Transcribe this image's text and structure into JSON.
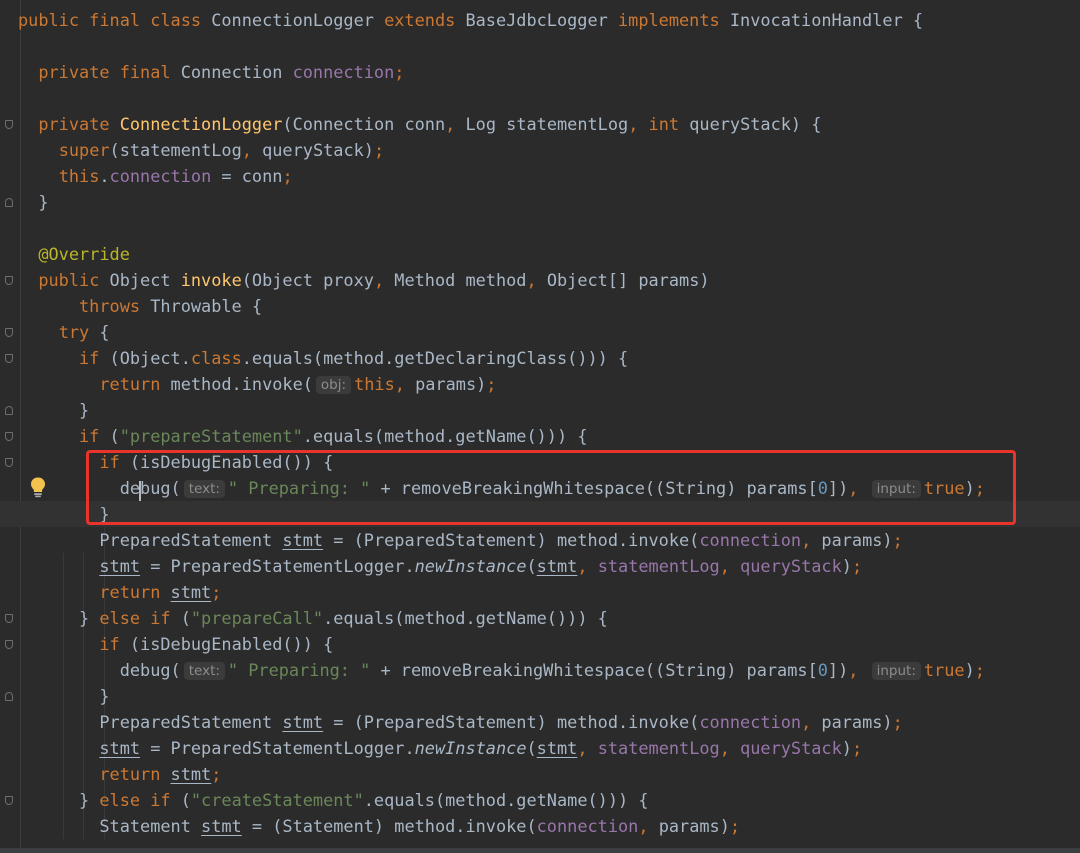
{
  "editor": {
    "language": "java",
    "colors": {
      "background": "#2b2b2b",
      "current_line": "#323232",
      "text": "#a9b7c6",
      "keyword": "#cc7832",
      "field": "#9876aa",
      "method_decl": "#ffc66d",
      "string": "#6a8759",
      "number": "#6897bb",
      "annotation": "#bbb529",
      "highlight_box": "#e8342b"
    },
    "highlighted_lines": [
      18,
      19,
      20
    ],
    "current_line": 19,
    "gutter_icons": [
      "fold-marker-icon",
      "lightbulb-icon"
    ],
    "lines": [
      [
        {
          "t": "public final class ",
          "c": "kw"
        },
        {
          "t": "ConnectionLogger "
        },
        {
          "t": "extends ",
          "c": "kw"
        },
        {
          "t": "BaseJdbcLogger "
        },
        {
          "t": "implements ",
          "c": "kw"
        },
        {
          "t": "InvocationHandler {"
        }
      ],
      [],
      [
        {
          "t": "  "
        },
        {
          "t": "private final ",
          "c": "kw"
        },
        {
          "t": "Connection "
        },
        {
          "t": "connection",
          "c": "field"
        },
        {
          "t": ";",
          "c": "kw"
        }
      ],
      [],
      [
        {
          "t": "  "
        },
        {
          "t": "private ",
          "c": "kw"
        },
        {
          "t": "ConnectionLogger",
          "c": "fn"
        },
        {
          "t": "(Connection conn"
        },
        {
          "t": ", ",
          "c": "kw"
        },
        {
          "t": "Log statementLog"
        },
        {
          "t": ", ",
          "c": "kw"
        },
        {
          "t": "int ",
          "c": "kw"
        },
        {
          "t": "queryStack) {"
        }
      ],
      [
        {
          "t": "    "
        },
        {
          "t": "super",
          "c": "kw"
        },
        {
          "t": "(statementLog"
        },
        {
          "t": ", ",
          "c": "kw"
        },
        {
          "t": "queryStack)"
        },
        {
          "t": ";",
          "c": "kw"
        }
      ],
      [
        {
          "t": "    "
        },
        {
          "t": "this",
          "c": "kw"
        },
        {
          "t": "."
        },
        {
          "t": "connection",
          "c": "field"
        },
        {
          "t": " = conn"
        },
        {
          "t": ";",
          "c": "kw"
        }
      ],
      [
        {
          "t": "  }"
        }
      ],
      [],
      [
        {
          "t": "  "
        },
        {
          "t": "@Override",
          "c": "ann"
        }
      ],
      [
        {
          "t": "  "
        },
        {
          "t": "public ",
          "c": "kw"
        },
        {
          "t": "Object "
        },
        {
          "t": "invoke",
          "c": "fn"
        },
        {
          "t": "(Object proxy"
        },
        {
          "t": ", ",
          "c": "kw"
        },
        {
          "t": "Method method"
        },
        {
          "t": ", ",
          "c": "kw"
        },
        {
          "t": "Object[] params)"
        }
      ],
      [
        {
          "t": "      "
        },
        {
          "t": "throws ",
          "c": "kw"
        },
        {
          "t": "Throwable {"
        }
      ],
      [
        {
          "t": "    "
        },
        {
          "t": "try ",
          "c": "kw"
        },
        {
          "t": "{"
        }
      ],
      [
        {
          "t": "      "
        },
        {
          "t": "if ",
          "c": "kw"
        },
        {
          "t": "(Object."
        },
        {
          "t": "class",
          "c": "kw"
        },
        {
          "t": ".equals(method.getDeclaringClass())) {"
        }
      ],
      [
        {
          "t": "        "
        },
        {
          "t": "return ",
          "c": "kw"
        },
        {
          "t": "method.invoke("
        },
        {
          "t": "obj:",
          "c": "hint"
        },
        {
          "t": "this",
          "c": "kw"
        },
        {
          "t": ", ",
          "c": "kw"
        },
        {
          "t": "params)"
        },
        {
          "t": ";",
          "c": "kw"
        }
      ],
      [
        {
          "t": "      }"
        }
      ],
      [
        {
          "t": "      "
        },
        {
          "t": "if ",
          "c": "kw"
        },
        {
          "t": "("
        },
        {
          "t": "\"prepareStatement\"",
          "c": "str"
        },
        {
          "t": ".equals(method.getName())) {"
        }
      ],
      [
        {
          "t": "        "
        },
        {
          "t": "if ",
          "c": "kw"
        },
        {
          "t": "(isDebugEnabled()) {"
        }
      ],
      [
        {
          "t": "          debug("
        },
        {
          "t": "text:",
          "c": "hint"
        },
        {
          "t": "\" Preparing: \"",
          "c": "str"
        },
        {
          "t": " + removeBreakingWhitespace((String) params["
        },
        {
          "t": "0",
          "c": "num"
        },
        {
          "t": "])"
        },
        {
          "t": ", ",
          "c": "kw"
        },
        {
          "t": "input:",
          "c": "hint"
        },
        {
          "t": "true",
          "c": "kw"
        },
        {
          "t": ")"
        },
        {
          "t": ";",
          "c": "kw"
        }
      ],
      [
        {
          "t": "        }"
        }
      ],
      [
        {
          "t": "        PreparedStatement "
        },
        {
          "t": "stmt",
          "c": "ul"
        },
        {
          "t": " = (PreparedStatement) method.invoke("
        },
        {
          "t": "connection",
          "c": "field"
        },
        {
          "t": ", ",
          "c": "kw"
        },
        {
          "t": "params)"
        },
        {
          "t": ";",
          "c": "kw"
        }
      ],
      [
        {
          "t": "        "
        },
        {
          "t": "stmt",
          "c": "ul"
        },
        {
          "t": " = PreparedStatementLogger."
        },
        {
          "t": "newInstance",
          "c": "static"
        },
        {
          "t": "("
        },
        {
          "t": "stmt",
          "c": "ul"
        },
        {
          "t": ", ",
          "c": "kw"
        },
        {
          "t": "statementLog",
          "c": "field"
        },
        {
          "t": ", ",
          "c": "kw"
        },
        {
          "t": "queryStack",
          "c": "field"
        },
        {
          "t": ")"
        },
        {
          "t": ";",
          "c": "kw"
        }
      ],
      [
        {
          "t": "        "
        },
        {
          "t": "return ",
          "c": "kw"
        },
        {
          "t": "stmt",
          "c": "ul"
        },
        {
          "t": ";",
          "c": "kw"
        }
      ],
      [
        {
          "t": "      } "
        },
        {
          "t": "else if ",
          "c": "kw"
        },
        {
          "t": "("
        },
        {
          "t": "\"prepareCall\"",
          "c": "str"
        },
        {
          "t": ".equals(method.getName())) {"
        }
      ],
      [
        {
          "t": "        "
        },
        {
          "t": "if ",
          "c": "kw"
        },
        {
          "t": "(isDebugEnabled()) {"
        }
      ],
      [
        {
          "t": "          debug("
        },
        {
          "t": "text:",
          "c": "hint"
        },
        {
          "t": "\" Preparing: \"",
          "c": "str"
        },
        {
          "t": " + removeBreakingWhitespace((String) params["
        },
        {
          "t": "0",
          "c": "num"
        },
        {
          "t": "])"
        },
        {
          "t": ", ",
          "c": "kw"
        },
        {
          "t": "input:",
          "c": "hint"
        },
        {
          "t": "true",
          "c": "kw"
        },
        {
          "t": ")"
        },
        {
          "t": ";",
          "c": "kw"
        }
      ],
      [
        {
          "t": "        }"
        }
      ],
      [
        {
          "t": "        PreparedStatement "
        },
        {
          "t": "stmt",
          "c": "ul"
        },
        {
          "t": " = (PreparedStatement) method.invoke("
        },
        {
          "t": "connection",
          "c": "field"
        },
        {
          "t": ", ",
          "c": "kw"
        },
        {
          "t": "params)"
        },
        {
          "t": ";",
          "c": "kw"
        }
      ],
      [
        {
          "t": "        "
        },
        {
          "t": "stmt",
          "c": "ul"
        },
        {
          "t": " = PreparedStatementLogger."
        },
        {
          "t": "newInstance",
          "c": "static"
        },
        {
          "t": "("
        },
        {
          "t": "stmt",
          "c": "ul"
        },
        {
          "t": ", ",
          "c": "kw"
        },
        {
          "t": "statementLog",
          "c": "field"
        },
        {
          "t": ", ",
          "c": "kw"
        },
        {
          "t": "queryStack",
          "c": "field"
        },
        {
          "t": ")"
        },
        {
          "t": ";",
          "c": "kw"
        }
      ],
      [
        {
          "t": "        "
        },
        {
          "t": "return ",
          "c": "kw"
        },
        {
          "t": "stmt",
          "c": "ul"
        },
        {
          "t": ";",
          "c": "kw"
        }
      ],
      [
        {
          "t": "      } "
        },
        {
          "t": "else if ",
          "c": "kw"
        },
        {
          "t": "("
        },
        {
          "t": "\"createStatement\"",
          "c": "str"
        },
        {
          "t": ".equals(method.getName())) {"
        }
      ],
      [
        {
          "t": "        Statement "
        },
        {
          "t": "stmt",
          "c": "ul"
        },
        {
          "t": " = (Statement) method.invoke("
        },
        {
          "t": "connection",
          "c": "field"
        },
        {
          "t": ", ",
          "c": "kw"
        },
        {
          "t": "params)"
        },
        {
          "t": ";",
          "c": "kw"
        }
      ]
    ]
  }
}
